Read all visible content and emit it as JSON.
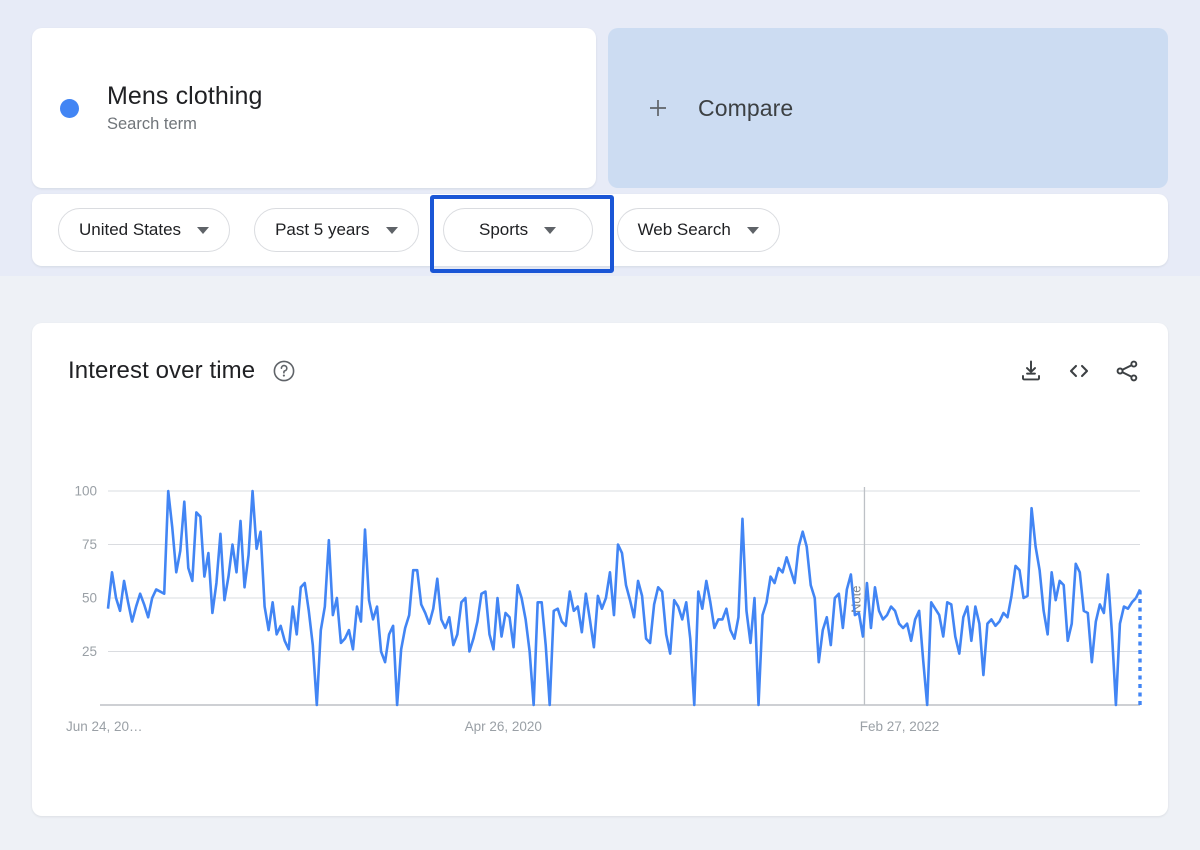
{
  "query": {
    "term_label": "Mens clothing",
    "term_type": "Search term",
    "dot_color": "#4285f4",
    "compare_label": "Compare"
  },
  "filters": {
    "items": [
      {
        "label": "United States",
        "focused": false
      },
      {
        "label": "Past 5 years",
        "focused": false
      },
      {
        "label": "Sports",
        "focused": true
      },
      {
        "label": "Web Search",
        "focused": false
      }
    ],
    "focus_color": "#1a56d6"
  },
  "chart_card": {
    "title": "Interest over time",
    "help_icon": "help-circle-icon",
    "actions": [
      {
        "name": "download-icon"
      },
      {
        "name": "embed-code-icon"
      },
      {
        "name": "share-icon"
      }
    ]
  },
  "chart_data": {
    "type": "line",
    "title": "Interest over time",
    "xlabel": "",
    "ylabel": "",
    "ylim": [
      0,
      100
    ],
    "yticks": [
      "25",
      "50",
      "75",
      "100"
    ],
    "ytick_values": [
      25,
      50,
      75,
      100
    ],
    "xticks": [
      "Jun 24, 20…",
      "Apr 26, 2020",
      "Feb 27, 2022"
    ],
    "xtick_positions": [
      0,
      0.383,
      0.767
    ],
    "grid": true,
    "legend_position": "none",
    "line_color": "#4285f4",
    "annotations": [
      {
        "label": "Note",
        "x_fraction": 0.733,
        "orientation": "vertical"
      }
    ],
    "partial_data_dashed_tail": true,
    "series": [
      {
        "name": "Mens clothing",
        "color": "#4285f4",
        "values": [
          45,
          62,
          50,
          44,
          58,
          48,
          39,
          46,
          52,
          47,
          41,
          50,
          54,
          53,
          52,
          100,
          83,
          62,
          72,
          95,
          64,
          58,
          90,
          88,
          60,
          71,
          43,
          57,
          80,
          49,
          60,
          75,
          62,
          86,
          55,
          70,
          100,
          73,
          81,
          46,
          35,
          48,
          33,
          37,
          30,
          26,
          46,
          33,
          55,
          57,
          44,
          28,
          0,
          35,
          46,
          77,
          42,
          50,
          29,
          31,
          35,
          26,
          46,
          39,
          82,
          49,
          40,
          46,
          25,
          20,
          33,
          37,
          0,
          26,
          36,
          42,
          63,
          63,
          47,
          43,
          38,
          45,
          59,
          40,
          36,
          41,
          28,
          33,
          48,
          50,
          25,
          31,
          39,
          52,
          53,
          33,
          26,
          50,
          32,
          43,
          41,
          27,
          56,
          50,
          40,
          25,
          0,
          48,
          48,
          28,
          0,
          44,
          45,
          39,
          37,
          53,
          44,
          46,
          34,
          52,
          40,
          27,
          51,
          45,
          50,
          62,
          42,
          75,
          71,
          56,
          49,
          41,
          58,
          51,
          31,
          29,
          47,
          55,
          53,
          33,
          24,
          49,
          46,
          40,
          48,
          31,
          0,
          53,
          45,
          58,
          48,
          36,
          40,
          40,
          45,
          35,
          31,
          41,
          87,
          44,
          29,
          50,
          0,
          42,
          48,
          60,
          57,
          64,
          62,
          69,
          63,
          57,
          74,
          81,
          74,
          56,
          50,
          20,
          35,
          41,
          28,
          50,
          52,
          36,
          54,
          61,
          42,
          43,
          32,
          57,
          36,
          55,
          44,
          40,
          42,
          46,
          44,
          38,
          36,
          38,
          30,
          40,
          44,
          21,
          0,
          48,
          45,
          42,
          32,
          48,
          47,
          32,
          24,
          41,
          46,
          30,
          46,
          38,
          14,
          38,
          40,
          37,
          39,
          43,
          41,
          51,
          65,
          63,
          50,
          51,
          92,
          74,
          63,
          44,
          33,
          62,
          49,
          58,
          56,
          30,
          38,
          66,
          62,
          44,
          43,
          20,
          39,
          47,
          43,
          61,
          34,
          0,
          38,
          46,
          45,
          48,
          50,
          54
        ]
      }
    ]
  }
}
